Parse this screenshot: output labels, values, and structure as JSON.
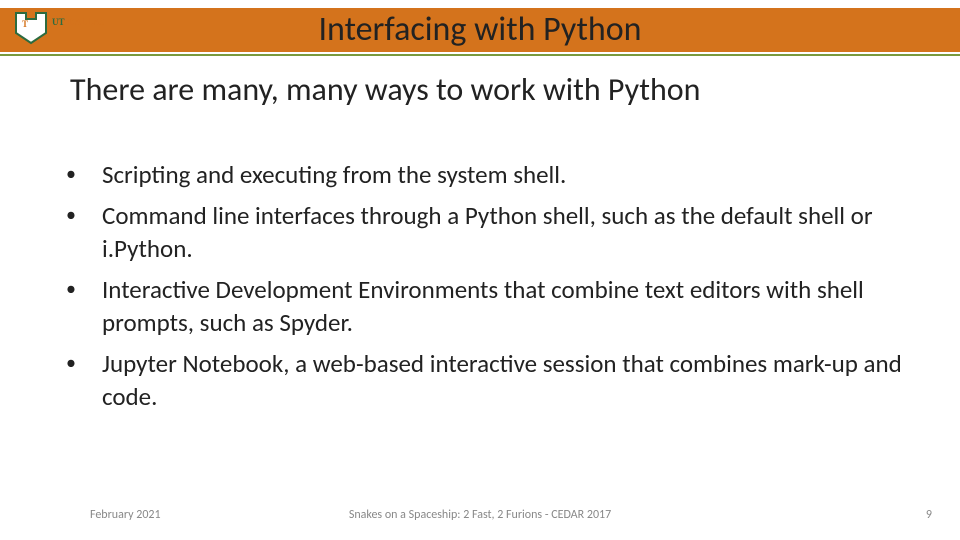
{
  "header": {
    "title": "Interfacing with Python",
    "logo_name": "ut-dallas-logo"
  },
  "subtitle": "There are many, many ways to work with Python",
  "bullets": [
    "Scripting and executing from the system shell.",
    "Command line interfaces through a Python shell, such as the default shell or i.Python.",
    "Interactive Development Environments that combine text editors with shell prompts, such as Spyder.",
    "Jupyter Notebook, a web-based interactive session that combines mark-up and code."
  ],
  "footer": {
    "date": "February 2021",
    "center": "Snakes on a Spaceship: 2 Fast, 2 Furions - CEDAR 2017",
    "page": "9"
  },
  "colors": {
    "band": "#d4731c",
    "rule": "#7a9a3d"
  }
}
